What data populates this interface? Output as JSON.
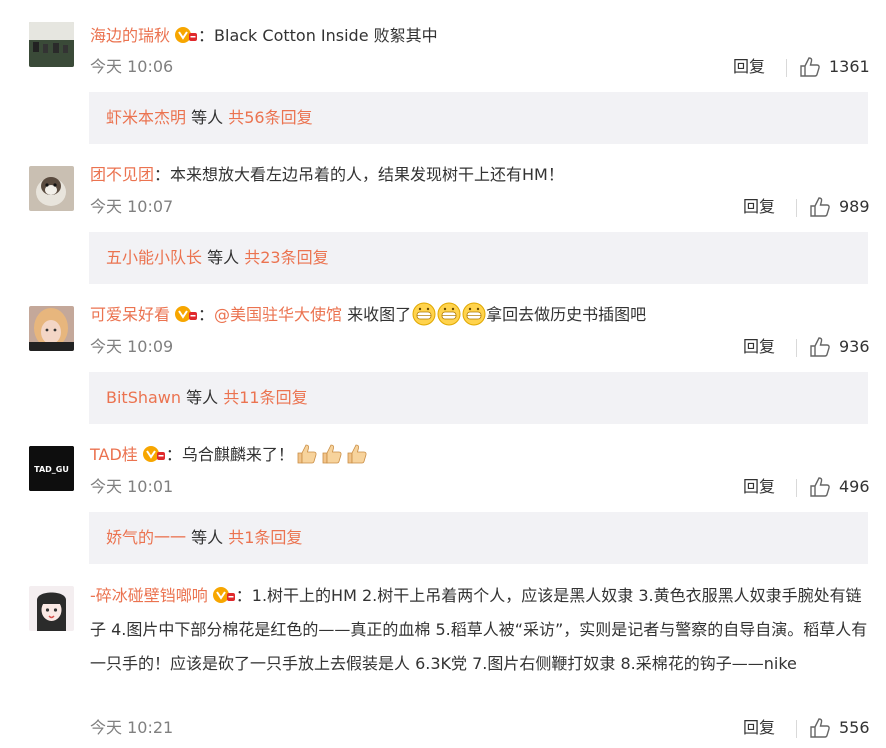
{
  "comments": [
    {
      "username": "海边的瑞秋",
      "text": "：Black Cotton Inside 败絮其中",
      "time": "今天 10:06",
      "reply_label": "回复",
      "likes": "1361",
      "replies": {
        "names": "虾米本杰明",
        "etc": " 等人 ",
        "count": "共56条回复"
      }
    },
    {
      "username": "团不见团",
      "text": "：本来想放大看左边吊着的人，结果发现树干上还有HM！",
      "time": "今天 10:07",
      "reply_label": "回复",
      "likes": "989",
      "replies": {
        "names": "五小能小队长",
        "etc": " 等人 ",
        "count": "共23条回复"
      }
    },
    {
      "username": "可爱呆好看",
      "colon": "：",
      "mention": "@美国驻华大使馆",
      "text": " 来收图了",
      "text_after": "拿回去做历史书插图吧",
      "time": "今天 10:09",
      "reply_label": "回复",
      "likes": "936",
      "replies": {
        "names": "BitShawn",
        "etc": " 等人 ",
        "count": "共11条回复"
      }
    },
    {
      "username": "TAD桂",
      "text": "：乌合麒麟来了！",
      "avatar_text": "TAD_GU",
      "time": "今天 10:01",
      "reply_label": "回复",
      "likes": "496",
      "replies": {
        "names": "娇气的一一",
        "etc": " 等人 ",
        "count": "共1条回复"
      }
    },
    {
      "username": "-碎冰碰壁铛啷响",
      "text": "：1.树干上的HM 2.树干上吊着两个人，应该是黑人奴隶 3.黄色衣服黑人奴隶手腕处有链子 4.图片中下部分棉花是红色的——真正的血棉 5.稻草人被“采访”，实则是记者与警察的自导自演。稻草人有一只手的！应该是砍了一只手放上去假装是人 6.3K党 7.图片右侧鞭打奴隶 8.采棉花的钩子——nike",
      "time": "今天 10:21",
      "reply_label": "回复",
      "likes": "556"
    }
  ],
  "colors": {
    "accent": "#eb7350",
    "meta": "#808080",
    "subbox_bg": "#f2f2f5"
  },
  "icons": {
    "vip_badge": "vip-badge-icon",
    "like": "thumbs-up-icon",
    "emoji_grin": "grin-emoji-icon",
    "emoji_thumb": "thumbs-up-emoji-icon"
  }
}
